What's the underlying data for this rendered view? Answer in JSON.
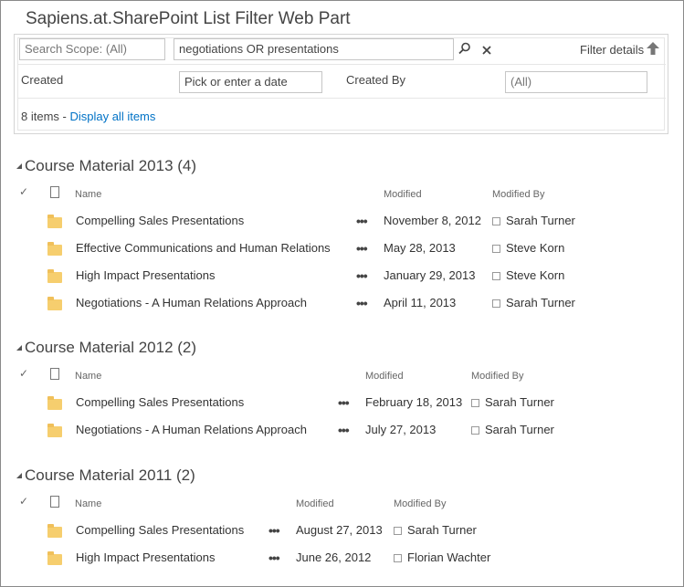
{
  "webpart": {
    "title": "Sapiens.at.SharePoint List Filter Web Part"
  },
  "filter": {
    "scope_placeholder": "Search Scope: (All)",
    "search_value": "negotiations OR presentations",
    "filter_details": "Filter details",
    "created_label": "Created",
    "created_placeholder": "Pick or enter a date",
    "created_by_label": "Created By",
    "created_by_placeholder": "(All)",
    "item_count": "8 items",
    "count_separator": " - ",
    "display_all": "Display all items"
  },
  "columns": {
    "name": "Name",
    "modified": "Modified",
    "modified_by": "Modified By"
  },
  "groups": [
    {
      "title": "Course Material 2013 (4)",
      "items": [
        {
          "name": "Compelling Sales Presentations",
          "modified": "November 8, 2012",
          "modified_by": "Sarah Turner"
        },
        {
          "name": "Effective Communications and Human Relations",
          "modified": "May 28, 2013",
          "modified_by": "Steve Korn"
        },
        {
          "name": "High Impact Presentations",
          "modified": "January 29, 2013",
          "modified_by": "Steve Korn"
        },
        {
          "name": "Negotiations - A Human Relations Approach",
          "modified": "April 11, 2013",
          "modified_by": "Sarah Turner"
        }
      ]
    },
    {
      "title": "Course Material 2012 (2)",
      "items": [
        {
          "name": "Compelling Sales Presentations",
          "modified": "February 18, 2013",
          "modified_by": "Sarah Turner"
        },
        {
          "name": "Negotiations - A Human Relations Approach",
          "modified": "July 27, 2013",
          "modified_by": "Sarah Turner"
        }
      ]
    },
    {
      "title": "Course Material 2011 (2)",
      "items": [
        {
          "name": "Compelling Sales Presentations",
          "modified": "August 27, 2013",
          "modified_by": "Sarah Turner"
        },
        {
          "name": "High Impact Presentations",
          "modified": "June 26, 2012",
          "modified_by": "Florian Wachter"
        }
      ]
    }
  ],
  "icons": {
    "search": "search-icon",
    "clear": "close-icon",
    "filter_details": "arrow-up-icon",
    "folder": "folder-icon",
    "document": "document-icon",
    "check": "checkmark-icon",
    "ellipsis": "ellipsis-icon"
  },
  "colors": {
    "link": "#0072c6",
    "folder": "#f6ce6e",
    "text": "#444444"
  }
}
